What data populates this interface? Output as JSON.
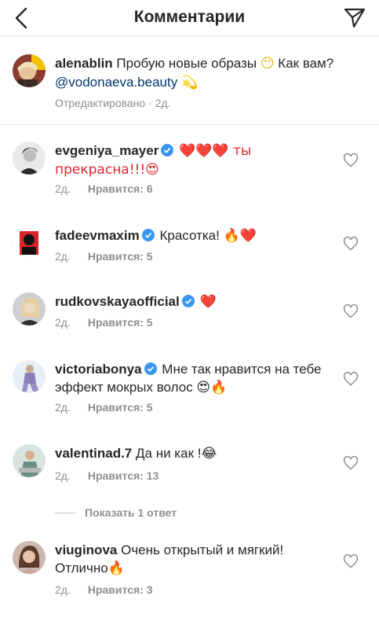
{
  "header": {
    "title": "Комментарии"
  },
  "caption": {
    "username": "alenablin",
    "text": "Пробую новые образы",
    "emoji1": "😶",
    "text2": "Как вам?",
    "mention": "@vodonaeva.beauty",
    "emoji2": "💫",
    "meta": "Отредактировано · 2д."
  },
  "comments": [
    {
      "username": "evgeniya_mayer",
      "verified": true,
      "text": "❤️❤️❤️ ты прекрасна!!!😍",
      "time": "2д.",
      "likes": "Нравится: 6"
    },
    {
      "username": "fadeevmaxim",
      "verified": true,
      "text": "Красотка! 🔥❤️",
      "time": "2д.",
      "likes": "Нравится: 5"
    },
    {
      "username": "rudkovskayaofficial",
      "verified": true,
      "text": "❤️",
      "time": "2д.",
      "likes": "Нравится: 5"
    },
    {
      "username": "victoriabonya",
      "verified": true,
      "text": "Мне так нравится на тебе эффект мокрых волос 😍🔥",
      "time": "2д.",
      "likes": "Нравится: 5"
    },
    {
      "username": "valentinad.7",
      "verified": false,
      "text": "Да ни как !😂",
      "time": "2д.",
      "likes": "Нравится: 13"
    },
    {
      "username": "viuginova",
      "verified": false,
      "text": "Очень открытый и мягкий! Отлично🔥",
      "time": "2д.",
      "likes": "Нравится: 3"
    }
  ],
  "view_replies": "Показать 1 ответ",
  "colors": {
    "accent_blue": "#3897f0",
    "mention": "#00376b",
    "muted": "#8e8e8e",
    "heart_red": "#e0242b"
  }
}
